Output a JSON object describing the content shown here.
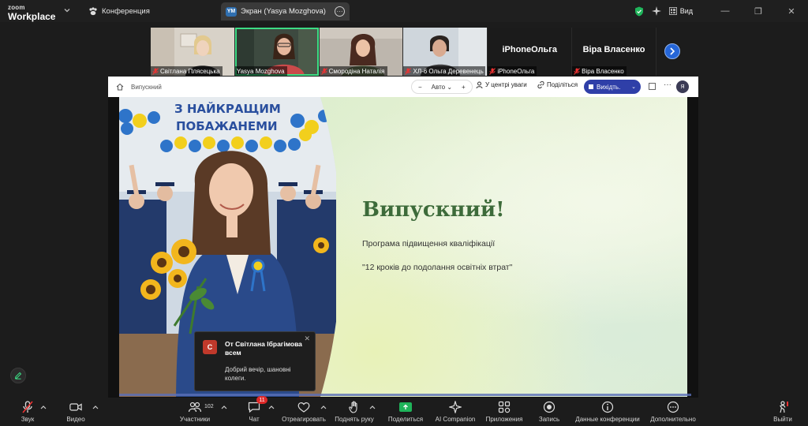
{
  "titlebar": {
    "logo_top": "zoom",
    "logo_bottom": "Workplace",
    "meeting_tab": "Конференция",
    "screen_badge": "YM",
    "screen_tab": "Экран (Yasya Mozghova)",
    "view_label": "Вид"
  },
  "participants": [
    {
      "name": "Світлана Плясецька",
      "muted": true
    },
    {
      "name": "Yasya Mozghova",
      "muted": false,
      "active": true
    },
    {
      "name": "Смородіна Наталія",
      "muted": true
    },
    {
      "name": "ХЛ-6 Ольга Деревенець",
      "muted": true
    },
    {
      "name": "iPhoneОльга",
      "display": "iPhoneОльга",
      "muted": true
    },
    {
      "name": "Віра Власенко",
      "display": "Віра Власенко",
      "muted": true
    }
  ],
  "share_toolbar": {
    "breadcrumb": "Випускний",
    "zoom_value": "Авто",
    "zoom_minus": "−",
    "zoom_plus": "+",
    "spotlight": "У центрі уваги",
    "share": "Поділіться",
    "exit": "Вихідть.",
    "avatar": "Я"
  },
  "slide": {
    "banner_line1": "З НАЙКРАЩИМ",
    "banner_line2": "ПОБАЖАНЕМИ",
    "title": "Випускний!",
    "subtitle": "Програма підвищення кваліфікації",
    "quote": "\"12 кроків до подолання освітніх втрат\""
  },
  "chat_toast": {
    "avatar": "С",
    "from": "От Світлана Ібрагімова всем",
    "message": "Добрий вечір, шановні колеги."
  },
  "toolbar": {
    "audio": "Звук",
    "video": "Видео",
    "participants": "Участники",
    "participants_count": "102",
    "chat": "Чат",
    "chat_badge": "11",
    "react": "Отреагировать",
    "raise_hand": "Поднять руку",
    "share": "Поделиться",
    "ai": "AI Companion",
    "apps": "Приложения",
    "record": "Запись",
    "info": "Данные конференции",
    "more": "Дополнительно",
    "leave": "Выйти"
  },
  "colors": {
    "active_speaker": "#3ddc84",
    "title_green": "#3d6b3a",
    "share_green": "#1fb45a",
    "badge_red": "#e02828",
    "exit_blue": "#2f3fa8"
  }
}
